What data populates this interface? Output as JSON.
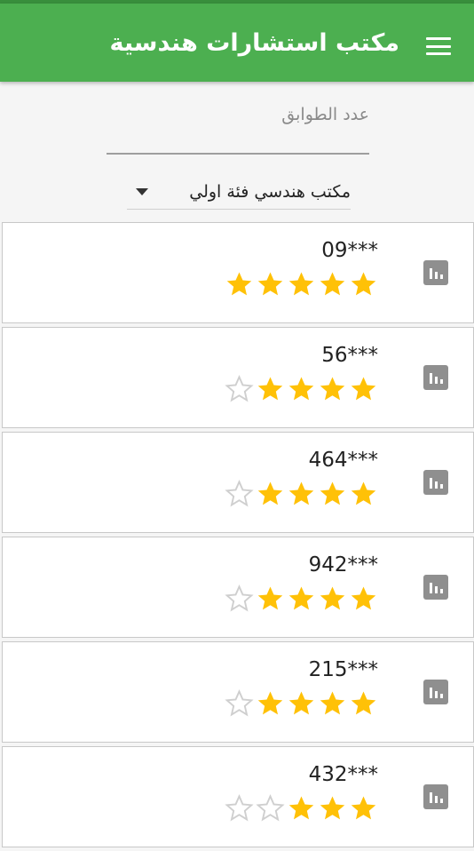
{
  "app": {
    "title": "مكتب استشارات هندسية"
  },
  "filters": {
    "floors_label": "عدد الطوابق",
    "floors_value": "",
    "office_category": "مكتب هندسي فئة اولي"
  },
  "colors": {
    "appbar": "#4caf50",
    "star_filled": "#ffc107",
    "star_empty": "#cfcfcf",
    "stats_icon": "#8f8f8f"
  },
  "offices": [
    {
      "plate": "09***",
      "rating": 5,
      "max_rating": 5,
      "icon": "stats-icon"
    },
    {
      "plate": "56***",
      "rating": 4,
      "max_rating": 5,
      "icon": "stats-icon"
    },
    {
      "plate": "464***",
      "rating": 4,
      "max_rating": 5,
      "icon": "stats-icon"
    },
    {
      "plate": "942***",
      "rating": 4,
      "max_rating": 5,
      "icon": "stats-icon"
    },
    {
      "plate": "215***",
      "rating": 4,
      "max_rating": 5,
      "icon": "stats-icon"
    },
    {
      "plate": "432***",
      "rating": 3,
      "max_rating": 5,
      "icon": "stats-icon"
    }
  ]
}
